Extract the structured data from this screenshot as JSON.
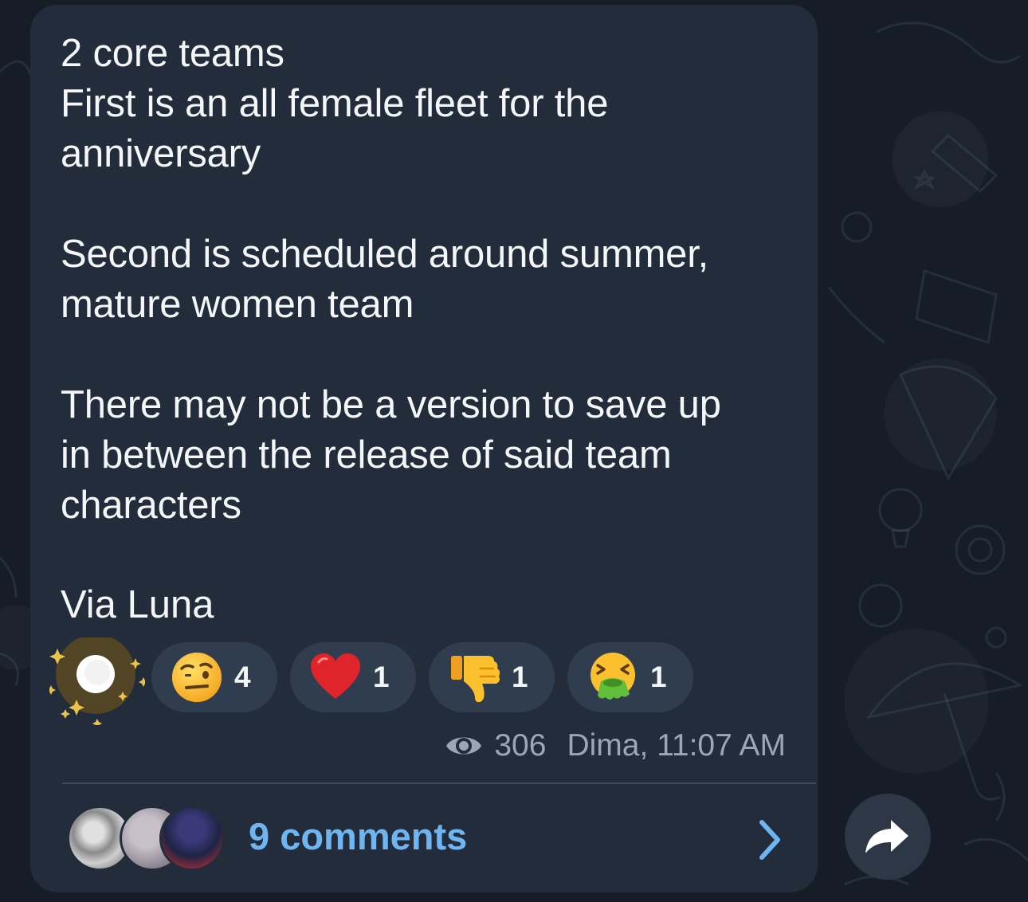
{
  "message": {
    "lines": [
      "2 core teams",
      "First is an all female fleet for the",
      "anniversary",
      "Second is scheduled around summer,",
      "mature women team",
      "There may not be a version to save up",
      "in between the release of said team",
      "characters"
    ],
    "signature": "Via Luna"
  },
  "reactions": [
    {
      "emoji": "sparkle-star-icon",
      "count": ""
    },
    {
      "emoji": "raised-eyebrow-face-icon",
      "count": "4"
    },
    {
      "emoji": "heart-icon",
      "count": "1"
    },
    {
      "emoji": "thumbs-down-icon",
      "count": "1"
    },
    {
      "emoji": "vomiting-face-icon",
      "count": "1"
    }
  ],
  "meta": {
    "views": "306",
    "author_time": "Dima, 11:07 AM"
  },
  "comments": {
    "label": "9 comments"
  },
  "colors": {
    "bubble": "#222c3a",
    "background": "#161d27",
    "link": "#6eb5f2",
    "reaction_pill": "#303d4e",
    "meta_text": "#9aa7b7"
  }
}
